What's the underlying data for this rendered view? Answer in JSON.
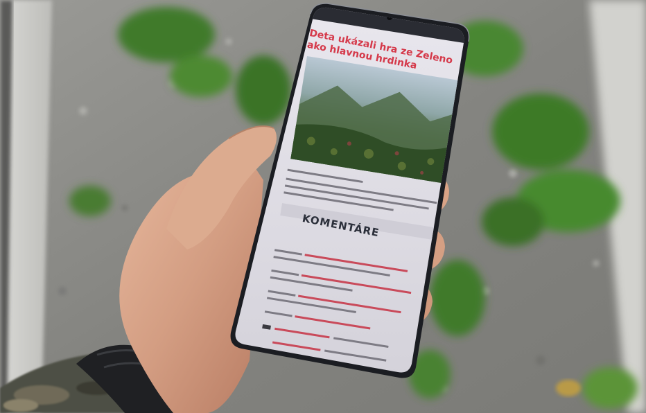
{
  "phone_screen": {
    "headline": "Deta ukázali hra ze Zeleno ako hlavnou hrdinka",
    "comments_heading": "KOMENTÁRE"
  },
  "colors": {
    "headline_red": "#d5394a",
    "link_red": "#c94a5a",
    "screen_bg": "#dedce3",
    "phone_frame": "#1b1d22",
    "gravel": "#8e8e8a"
  }
}
